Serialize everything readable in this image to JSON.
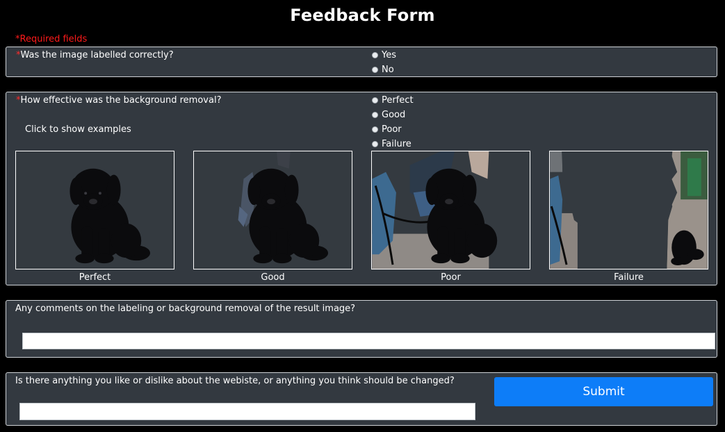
{
  "page": {
    "title": "Feedback Form",
    "required_note": "*Required fields"
  },
  "q1": {
    "star": "*",
    "question": "Was the image labelled correctly?",
    "options": [
      "Yes",
      "No"
    ]
  },
  "q2": {
    "star": "*",
    "question": "How effective was the background removal?",
    "options": [
      "Perfect",
      "Good",
      "Poor",
      "Failure"
    ],
    "examples_link": "Click to show examples",
    "examples": [
      {
        "label": "Perfect",
        "image": "puppy-perfect-cutout"
      },
      {
        "label": "Good",
        "image": "puppy-good-cutout"
      },
      {
        "label": "Poor",
        "image": "puppy-poor-cutout"
      },
      {
        "label": "Failure",
        "image": "puppy-failure-cutout"
      }
    ]
  },
  "q3": {
    "question": "Any comments on the labeling or background removal of the result image?",
    "input_value": "",
    "input_placeholder": ""
  },
  "q4": {
    "question": "Is there anything you like or dislike about the webiste, or anything you think should be changed?",
    "input_value": "",
    "input_placeholder": "",
    "submit_label": "Submit"
  },
  "colors": {
    "background": "#000000",
    "panel": "#333940",
    "required": "#ff1a1a",
    "submit": "#0d7df8"
  }
}
